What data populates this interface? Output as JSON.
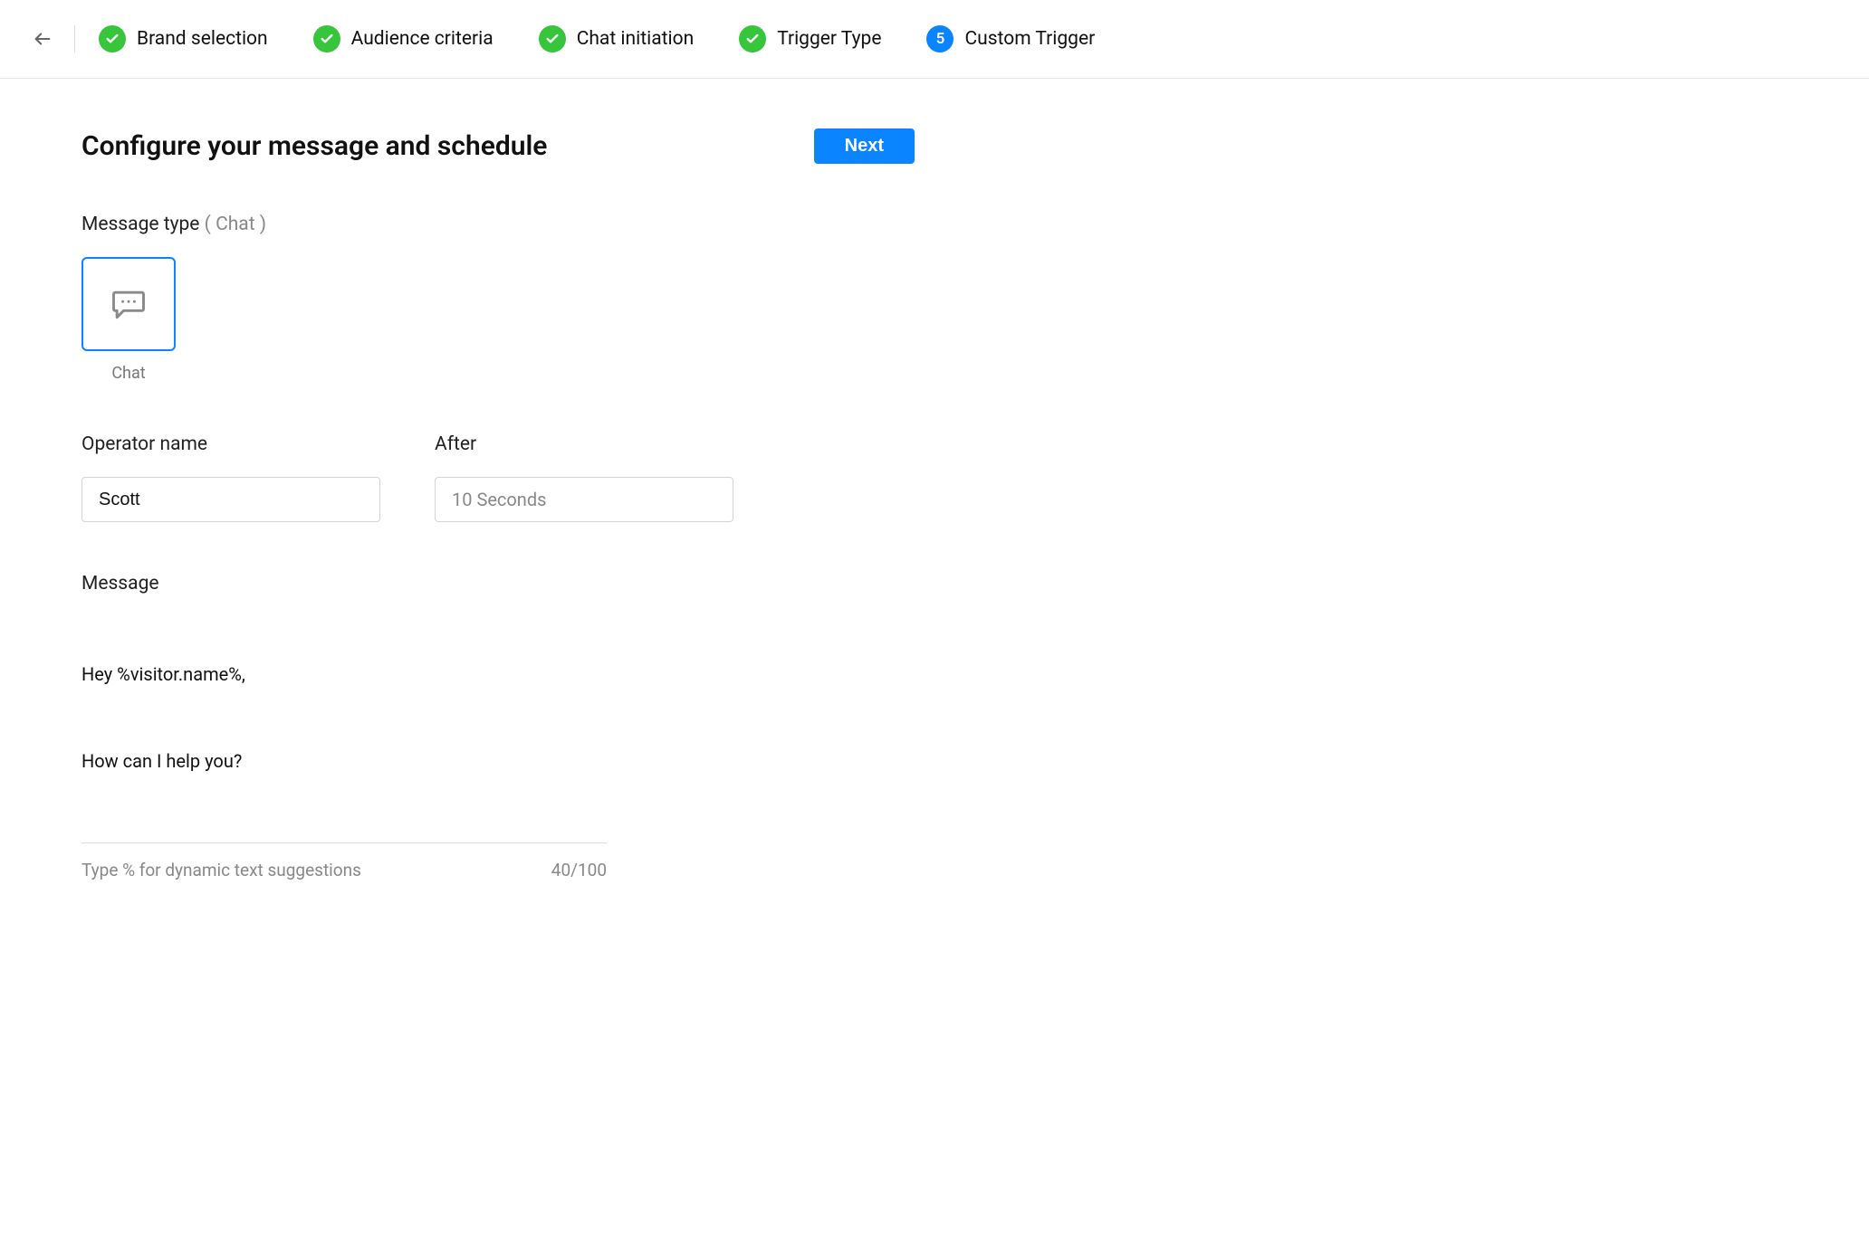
{
  "stepper": {
    "steps": [
      {
        "label": "Brand selection",
        "status": "done"
      },
      {
        "label": "Audience criteria",
        "status": "done"
      },
      {
        "label": "Chat initiation",
        "status": "done"
      },
      {
        "label": "Trigger Type",
        "status": "done"
      },
      {
        "label": "Custom Trigger",
        "status": "current",
        "number": "5"
      }
    ]
  },
  "page": {
    "title": "Configure your message and schedule",
    "next_label": "Next"
  },
  "message_type": {
    "label": "Message type",
    "selected_suffix": "( Chat )",
    "option_caption": "Chat"
  },
  "operator": {
    "label": "Operator name",
    "value": "Scott"
  },
  "after": {
    "label": "After",
    "value": "10 Seconds"
  },
  "message": {
    "label": "Message",
    "line1": "Hey %visitor.name%,",
    "line2": "How can I help you?",
    "hint": "Type % for dynamic text suggestions",
    "counter": "40/100"
  }
}
